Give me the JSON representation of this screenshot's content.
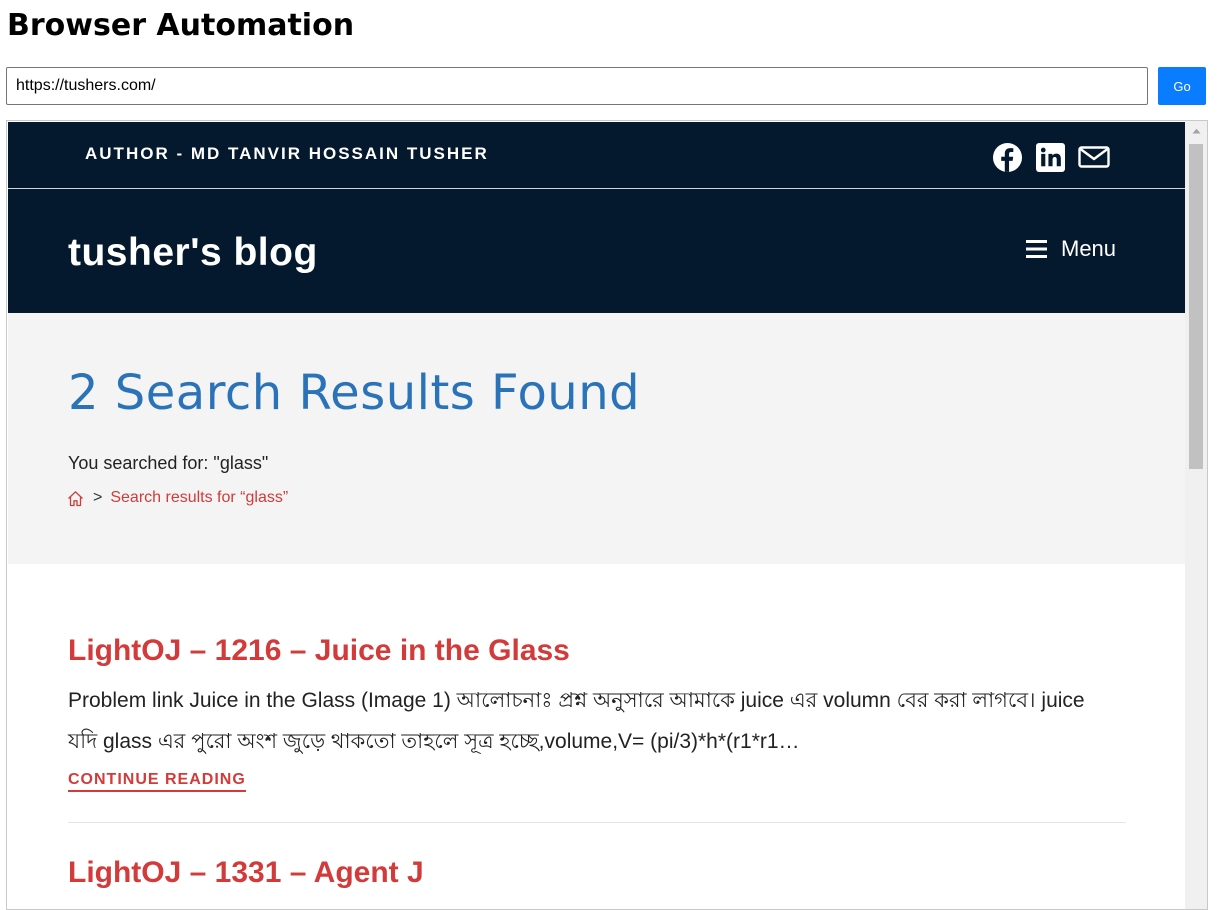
{
  "app": {
    "title": "Browser Automation"
  },
  "address_bar": {
    "url": "https://tushers.com/",
    "go_label": "Go"
  },
  "site": {
    "author_banner": "AUTHOR - MD TANVIR HOSSAIN TUSHER",
    "social_icons": [
      "facebook-icon",
      "linkedin-icon",
      "mail-icon"
    ],
    "title": "tusher's blog",
    "menu_label": "Menu"
  },
  "search": {
    "heading": "2 Search Results Found",
    "searched_for": "You searched for: \"glass\"",
    "breadcrumb_separator": ">",
    "breadcrumb_current": "Search results for “glass”"
  },
  "results": [
    {
      "title": "LightOJ – 1216 – Juice in the Glass",
      "excerpt": "Problem link Juice in the Glass (Image 1) আলোচনাঃ প্রশ্ন অনুসারে আমাকে juice এর volumn বের করা লাগবে। juice যদি glass এর পুরো অংশ জুড়ে থাকতো তাহলে সূত্র হচ্ছে,volume,V= (pi/3)*h*(r1*r1…",
      "continue_label": "CONTINUE READING"
    },
    {
      "title": "LightOJ – 1331 – Agent J"
    }
  ],
  "colors": {
    "header_bg": "#04192e",
    "accent_red": "#d33a3a",
    "heading_blue": "#2b73b9",
    "go_button": "#0a7cff"
  }
}
